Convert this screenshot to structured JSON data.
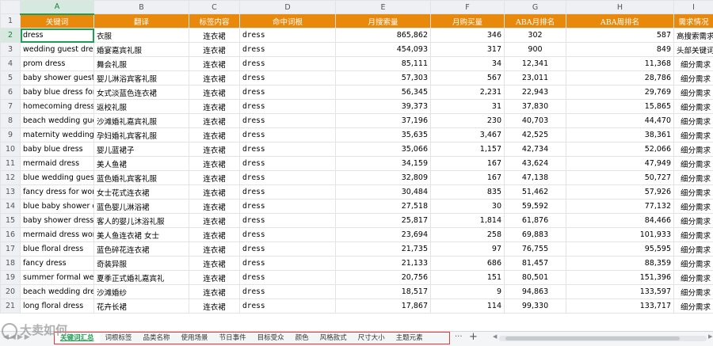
{
  "columns": [
    "A",
    "B",
    "C",
    "D",
    "E",
    "F",
    "G",
    "H",
    "I"
  ],
  "header": [
    "关键词",
    "翻译",
    "标签内容",
    "命中词根",
    "月搜索量",
    "月购买量",
    "ABA月排名",
    "ABA周排名",
    "需求情况"
  ],
  "rows": [
    [
      "dress",
      "衣服",
      "连衣裙",
      "dress",
      "865,862",
      "346",
      "302",
      "587",
      "高搜索需求"
    ],
    [
      "wedding guest dress",
      "婚宴嘉宾礼服",
      "连衣裙",
      "dress",
      "454,093",
      "317",
      "900",
      "849",
      "头部关键词"
    ],
    [
      "prom dress",
      "舞会礼服",
      "连衣裙",
      "dress",
      "85,111",
      "34",
      "12,341",
      "11,368",
      "细分需求"
    ],
    [
      "baby shower guest d",
      "婴儿淋浴宾客礼服",
      "连衣裙",
      "dress",
      "57,303",
      "567",
      "23,011",
      "28,786",
      "细分需求"
    ],
    [
      "baby blue dress for w",
      "女式淡蓝色连衣裙",
      "连衣裙",
      "dress",
      "56,345",
      "2,231",
      "22,943",
      "29,769",
      "细分需求"
    ],
    [
      "homecoming dress",
      "返校礼服",
      "连衣裙",
      "dress",
      "39,373",
      "31",
      "37,830",
      "15,865",
      "细分需求"
    ],
    [
      "beach wedding gues",
      "沙滩婚礼嘉宾礼服",
      "连衣裙",
      "dress",
      "37,196",
      "230",
      "40,703",
      "44,470",
      "细分需求"
    ],
    [
      "maternity wedding g",
      "孕妇婚礼宾客礼服",
      "连衣裙",
      "dress",
      "35,635",
      "3,467",
      "42,525",
      "38,361",
      "细分需求"
    ],
    [
      "baby blue dress",
      "婴儿蓝裙子",
      "连衣裙",
      "dress",
      "35,066",
      "1,157",
      "42,734",
      "52,066",
      "细分需求"
    ],
    [
      "mermaid dress",
      "美人鱼裙",
      "连衣裙",
      "dress",
      "34,159",
      "167",
      "43,624",
      "47,949",
      "细分需求"
    ],
    [
      "blue wedding guest",
      "蓝色婚礼宾客礼服",
      "连衣裙",
      "dress",
      "32,809",
      "167",
      "47,138",
      "50,727",
      "细分需求"
    ],
    [
      "fancy dress for wome",
      "女士花式连衣裙",
      "连衣裙",
      "dress",
      "30,484",
      "835",
      "51,462",
      "57,926",
      "细分需求"
    ],
    [
      "blue baby shower dr",
      "蓝色婴儿淋浴裙",
      "连衣裙",
      "dress",
      "27,518",
      "30",
      "59,592",
      "77,132",
      "细分需求"
    ],
    [
      "baby shower dress fo",
      "客人的婴儿沐浴礼服",
      "连衣裙",
      "dress",
      "25,817",
      "1,814",
      "61,876",
      "84,466",
      "细分需求"
    ],
    [
      "mermaid dress wome",
      "美人鱼连衣裙 女士",
      "连衣裙",
      "dress",
      "23,694",
      "258",
      "69,883",
      "101,933",
      "细分需求"
    ],
    [
      "blue floral dress",
      "蓝色碎花连衣裙",
      "连衣裙",
      "dress",
      "21,735",
      "97",
      "76,755",
      "95,595",
      "细分需求"
    ],
    [
      "fancy dress",
      "奇装异服",
      "连衣裙",
      "dress",
      "21,133",
      "686",
      "81,457",
      "88,359",
      "细分需求"
    ],
    [
      "summer formal wedd",
      "夏季正式婚礼嘉宾礼",
      "连衣裙",
      "dress",
      "20,756",
      "151",
      "80,501",
      "151,396",
      "细分需求"
    ],
    [
      "beach wedding dress",
      "沙滩婚纱",
      "连衣裙",
      "dress",
      "18,517",
      "9",
      "94,863",
      "133,597",
      "细分需求"
    ],
    [
      "long floral dress",
      "花卉长裙",
      "连衣裙",
      "dress",
      "17,867",
      "114",
      "99,330",
      "133,717",
      "细分需求"
    ]
  ],
  "tabs": [
    "关键词汇总",
    "词根标签",
    "品类名称",
    "使用场景",
    "节日事件",
    "目标受众",
    "颜色",
    "风格款式",
    "尺寸大小",
    "主题元素"
  ],
  "more_label": "···",
  "add_label": "+",
  "watermark": "大卖如何",
  "colors": {
    "header_fill": "#e8890c",
    "selection": "#1f9d55",
    "tab_box": "#e53935"
  }
}
